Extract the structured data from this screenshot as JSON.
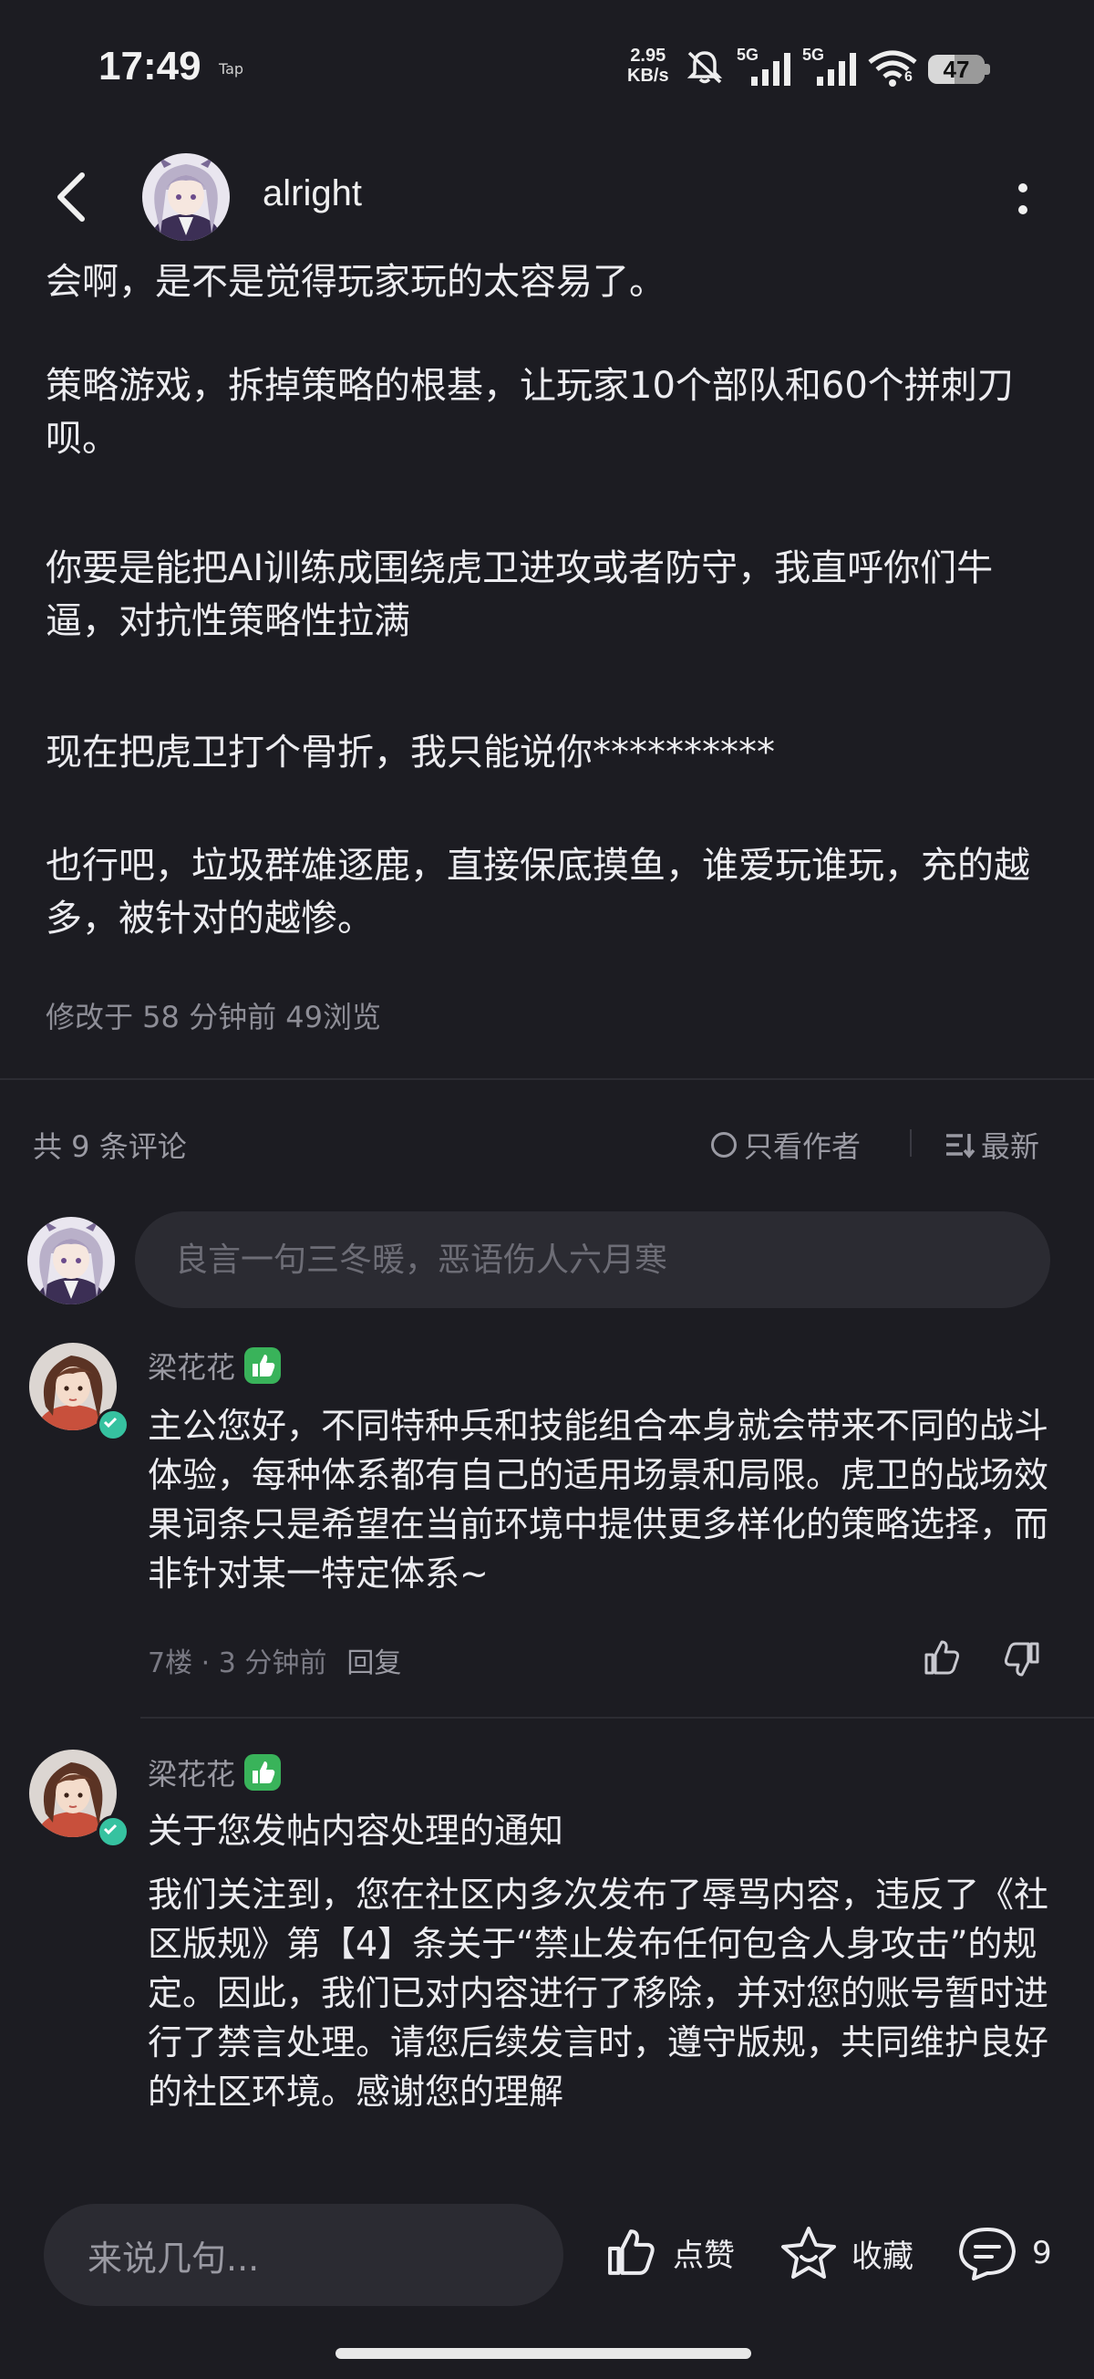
{
  "status_bar": {
    "time": "17:49",
    "tap": "Tap",
    "net_speed_value": "2.95",
    "net_speed_unit": "KB/s",
    "signal1_label": "5G",
    "signal2_label": "5G",
    "wifi_label": "6",
    "battery_level": "47"
  },
  "header": {
    "username": "alright"
  },
  "post": {
    "paragraphs": [
      "会啊，是不是觉得玩家玩的太容易了。",
      "策略游戏，拆掉策略的根基，让玩家10个部队和60个拼刺刀呗。",
      "你要是能把AI训练成围绕虎卫进攻或者防守，我直呼你们牛逼，对抗性策略性拉满",
      "现在把虎卫打个骨折，我只能说你**********",
      "也行吧，垃圾群雄逐鹿，直接保底摸鱼，谁爱玩谁玩，充的越多，被针对的越惨。"
    ],
    "meta": "修改于 58 分钟前  49浏览"
  },
  "comments_header": {
    "count": "共 9 条评论",
    "only_author": "只看作者",
    "sort": "最新"
  },
  "comment_input": {
    "placeholder": "良言一句三冬暖，恶语伤人六月寒"
  },
  "comments": [
    {
      "author": "梁花花",
      "text": "主公您好，不同特种兵和技能组合本身就会带来不同的战斗体验，每种体系都有自己的适用场景和局限。虎卫的战场效果词条只是希望在当前环境中提供更多样化的策略选择，而非针对某一特定体系~",
      "meta": "7楼 · 3 分钟前",
      "reply": "回复"
    },
    {
      "author": "梁花花",
      "title": "关于您发帖内容处理的通知",
      "text": "我们关注到，您在社区内多次发布了辱骂内容，违反了《社区版规》第【4】条关于“禁止发布任何包含人身攻击”的规定。因此，我们已对内容进行了移除，并对您的账号暂时进行了禁言处理。请您后续发言时，遵守版规，共同维护良好的社区环境。感谢您的理解"
    }
  ],
  "bottom_bar": {
    "input_placeholder": "来说几句...",
    "like": "点赞",
    "favorite": "收藏",
    "comment_count": "9"
  },
  "colors": {
    "background": "#1c1c22",
    "input_bg": "#2b2b32",
    "badge_green": "#39b35a",
    "verified_teal": "#36c2a0"
  }
}
